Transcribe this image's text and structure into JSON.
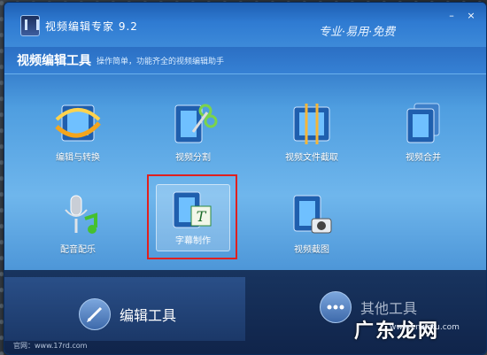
{
  "window": {
    "title": "视频编辑专家 9.2",
    "slogan": "专业·易用·免费",
    "controls": {
      "minimize": "–",
      "close": "×"
    }
  },
  "subheader": {
    "title": "视频编辑工具",
    "description": "操作简单，功能齐全的视频编辑助手"
  },
  "tools": [
    {
      "label": "编辑与转换",
      "icon": "film-convert-icon"
    },
    {
      "label": "视频分割",
      "icon": "film-scissors-icon"
    },
    {
      "label": "视频文件截取",
      "icon": "film-crop-icon"
    },
    {
      "label": "视频合并",
      "icon": "film-merge-icon"
    },
    {
      "label": "配音配乐",
      "icon": "microphone-music-icon"
    },
    {
      "label": "字幕制作",
      "icon": "film-subtitle-icon"
    },
    {
      "label": "视频截图",
      "icon": "film-camera-icon"
    }
  ],
  "bottom_tabs": [
    {
      "label": "编辑工具",
      "icon": "pencil-icon",
      "active": true
    },
    {
      "label": "其他工具",
      "icon": "more-icon",
      "active": false
    }
  ],
  "footer": {
    "url": "官网：www.17rd.com"
  },
  "watermark": {
    "text": "广东龙网",
    "sub": "www.cnwotu.com"
  },
  "colors": {
    "highlight": "#e0201e",
    "accent": "#2f7bd2"
  }
}
